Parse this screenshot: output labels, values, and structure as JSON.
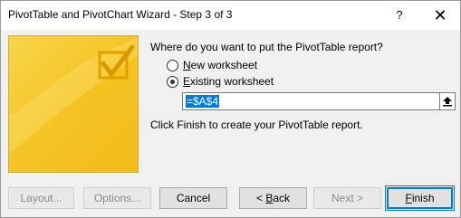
{
  "window": {
    "title": "PivotTable and PivotChart Wizard - Step 3 of 3",
    "help_label": "?",
    "close_label": "✕"
  },
  "main": {
    "prompt": "Where do you want to put the PivotTable report?",
    "options": [
      {
        "accel": "N",
        "rest": "ew worksheet",
        "selected": false
      },
      {
        "accel": "E",
        "rest": "xisting worksheet",
        "selected": true
      }
    ],
    "location_value": "=$A$4",
    "finish_note": "Click Finish to create your PivotTable report."
  },
  "buttons": {
    "layout": "Layout...",
    "options": "Options...",
    "cancel": "Cancel",
    "back_prefix": "< ",
    "back_accel": "B",
    "back_rest": "ack",
    "next": "Next >",
    "finish_accel": "F",
    "finish_rest": "inish"
  },
  "colors": {
    "accent": "#0078d7",
    "art_yellow": "#f5c518"
  },
  "icons": {
    "collapse": "collapse-dialog-arrow-icon",
    "art": "wizard-checkmark-illustration"
  }
}
